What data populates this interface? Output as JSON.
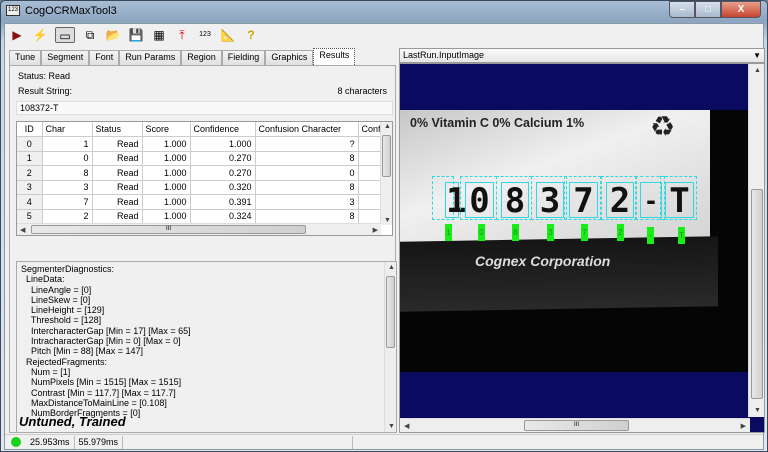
{
  "window": {
    "title": "CogOCRMaxTool3",
    "app_icon": "123",
    "buttons": {
      "minimize": "–",
      "maximize": "□",
      "close": "X"
    }
  },
  "toolbar": {
    "icons": [
      "run-icon",
      "electric-run-icon",
      "show-panel-icon",
      "floating-panel-icon",
      "open-icon",
      "save-icon",
      "reset-icon",
      "import-icon",
      "font-icon",
      "measure-icon",
      "help-icon"
    ]
  },
  "tabs": [
    {
      "label": "Tune"
    },
    {
      "label": "Segment"
    },
    {
      "label": "Font"
    },
    {
      "label": "Run Params"
    },
    {
      "label": "Region"
    },
    {
      "label": "Fielding"
    },
    {
      "label": "Graphics"
    },
    {
      "label": "Results",
      "active": true
    }
  ],
  "results": {
    "status": "Status: Read",
    "result_string_label": "Result String:",
    "char_count": "8 characters",
    "result_string": "108372-T",
    "columns": [
      "ID",
      "Char",
      "Status",
      "Score",
      "Confidence",
      "Confusion Character",
      "Conf"
    ],
    "rows": [
      [
        "0",
        "1",
        "Read",
        "1.000",
        "1.000",
        "?"
      ],
      [
        "1",
        "0",
        "Read",
        "1.000",
        "0.270",
        "8"
      ],
      [
        "2",
        "8",
        "Read",
        "1.000",
        "0.270",
        "0"
      ],
      [
        "3",
        "3",
        "Read",
        "1.000",
        "0.320",
        "8"
      ],
      [
        "4",
        "7",
        "Read",
        "1.000",
        "0.391",
        "3"
      ],
      [
        "5",
        "2",
        "Read",
        "1.000",
        "0.324",
        "8"
      ]
    ],
    "scroll_grip": "III"
  },
  "diagnostics": [
    "SegmenterDiagnostics:",
    "  LineData:",
    "    LineAngle = [0]",
    "    LineSkew = [0]",
    "    LineHeight = [129]",
    "    Threshold = [128]",
    "    IntercharacterGap [Min = 17] [Max = 65]",
    "    IntracharacterGap [Min = 0] [Max = 0]",
    "    Pitch [Min = 88] [Max = 147]",
    "  RejectedFragments:",
    "    Num = [1]",
    "    NumPixels [Min = 1515] [Max = 1515]",
    "    Contrast [Min = 117.7] [Max = 117.7]",
    "    MaxDistanceToMainLine = [0.108]",
    "    NumBorderFragments = [0]"
  ],
  "train_state": "Untuned, Trained",
  "statusbar": {
    "indicator_color": "#19d219",
    "time1": "25.953ms",
    "time2": "55.979ms"
  },
  "viewer": {
    "image_select": "LastRun.InputImage",
    "background_color": "#0a0a60",
    "overlay_color": "#2fd9e0",
    "label_color": "#17ee17",
    "photo_text": {
      "nutrition": "0%  Vitamin C 0%  Calcium 1%",
      "brand": "Cognex Corporation"
    },
    "chars": [
      "1",
      "0",
      "8",
      "3",
      "7",
      "2",
      "-",
      "T"
    ]
  }
}
